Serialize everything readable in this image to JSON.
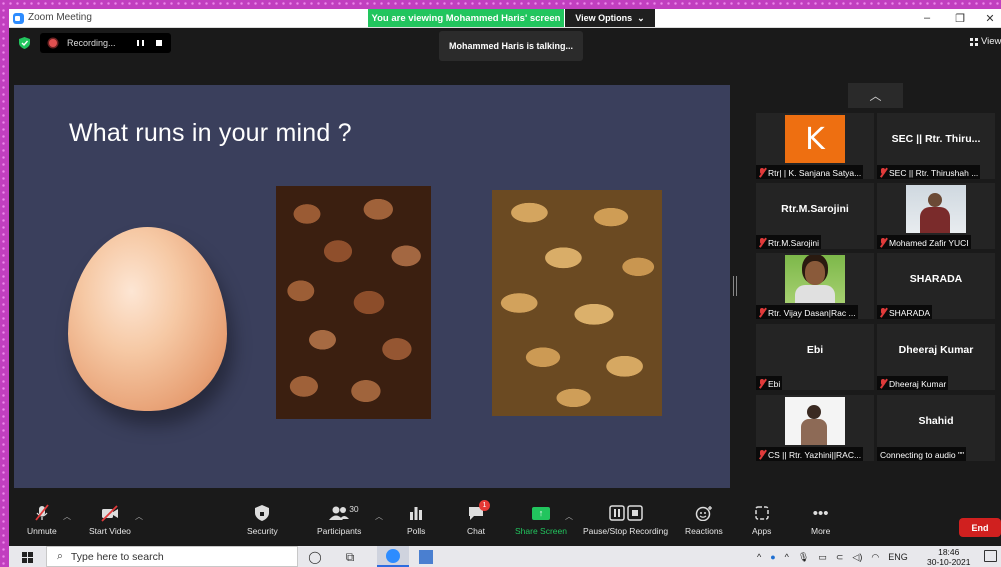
{
  "window": {
    "title": "Zoom Meeting",
    "viewing_banner": "You are viewing Mohammed Haris' screen",
    "view_options": "View Options"
  },
  "recording": {
    "label": "Recording..."
  },
  "speaker_banner": "Mohammed Haris is talking...",
  "view_button": "View",
  "slide": {
    "title": "What runs in your mind ?"
  },
  "gallery": {
    "tiles": [
      {
        "name": "",
        "footer": "Rtr| | K. Sanjana Satya...",
        "avatar_letter": "K"
      },
      {
        "name": "SEC || Rtr. Thiru...",
        "footer": "SEC || Rtr. Thirushah ..."
      },
      {
        "name": "Rtr.M.Sarojini",
        "footer": "Rtr.M.Sarojini"
      },
      {
        "name": "",
        "footer": "Mohamed Zafir YUCI"
      },
      {
        "name": "",
        "footer": "Rtr. Vijay Dasan|Rac ..."
      },
      {
        "name": "SHARADA",
        "footer": "SHARADA"
      },
      {
        "name": "Ebi",
        "footer": "Ebi"
      },
      {
        "name": "Dheeraj Kumar",
        "footer": "Dheeraj Kumar"
      },
      {
        "name": "",
        "footer": "CS || Rtr. Yazhini||RAC..."
      },
      {
        "name": "Shahid",
        "footer": "Connecting to audio \"\""
      }
    ]
  },
  "controls": {
    "unmute": "Unmute",
    "start_video": "Start Video",
    "security": "Security",
    "participants": "Participants",
    "participants_count": "30",
    "polls": "Polls",
    "chat": "Chat",
    "chat_badge": "1",
    "share_screen": "Share Screen",
    "pause_stop_recording": "Pause/Stop Recording",
    "reactions": "Reactions",
    "apps": "Apps",
    "more": "More",
    "end": "End"
  },
  "taskbar": {
    "search_placeholder": "Type here to search",
    "language": "ENG",
    "time": "18:46",
    "date": "30-10-2021"
  },
  "colors": {
    "share_green": "#22c55e",
    "end_red": "#d0201f",
    "slide_bg": "#3a3f5c",
    "avatar_orange": "#ee6f11"
  }
}
